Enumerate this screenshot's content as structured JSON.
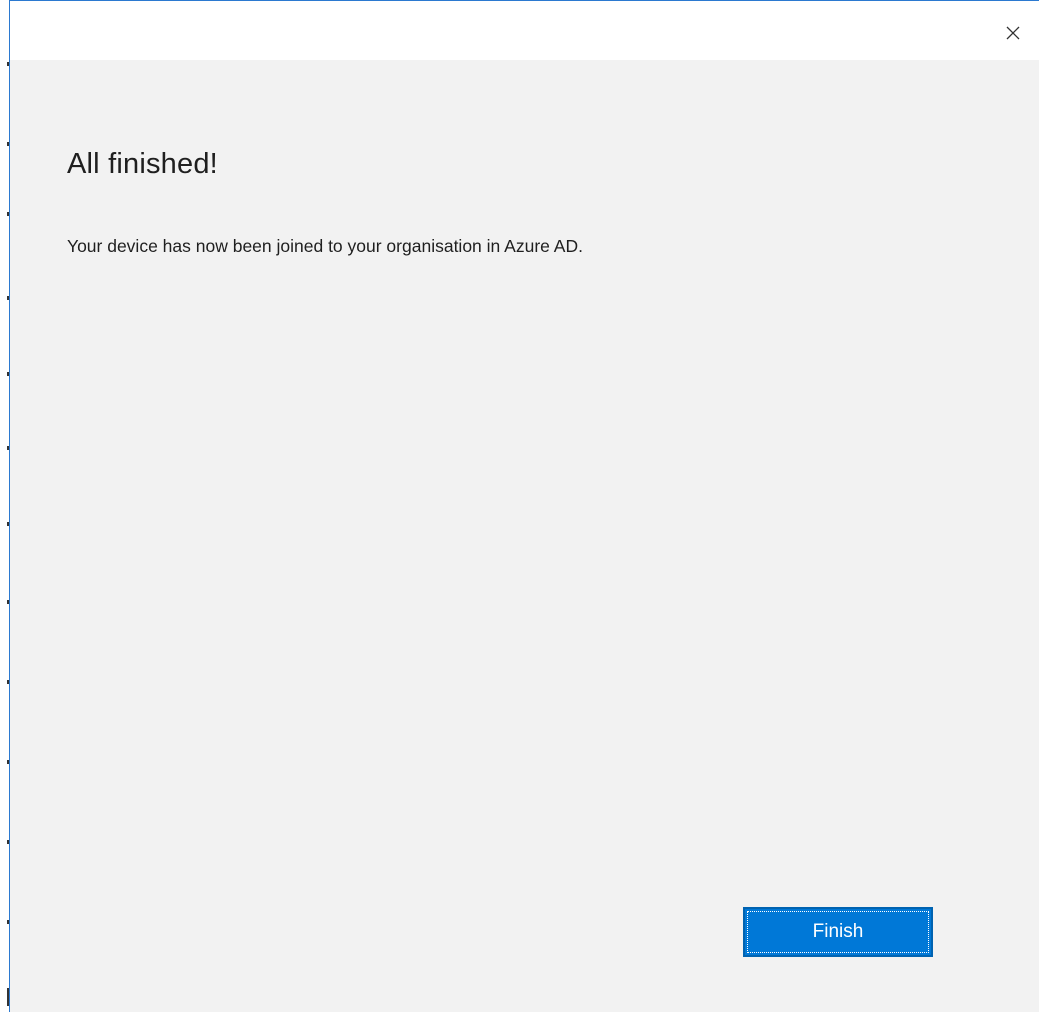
{
  "dialog": {
    "close_icon": "close-icon",
    "heading": "All finished!",
    "message": "Your device has now been joined to your organisation in Azure AD.",
    "finish_label": "Finish"
  },
  "colors": {
    "accent": "#0078d7",
    "background": "#f2f2f2",
    "titlebar": "#ffffff",
    "text": "#1f1f1f"
  }
}
